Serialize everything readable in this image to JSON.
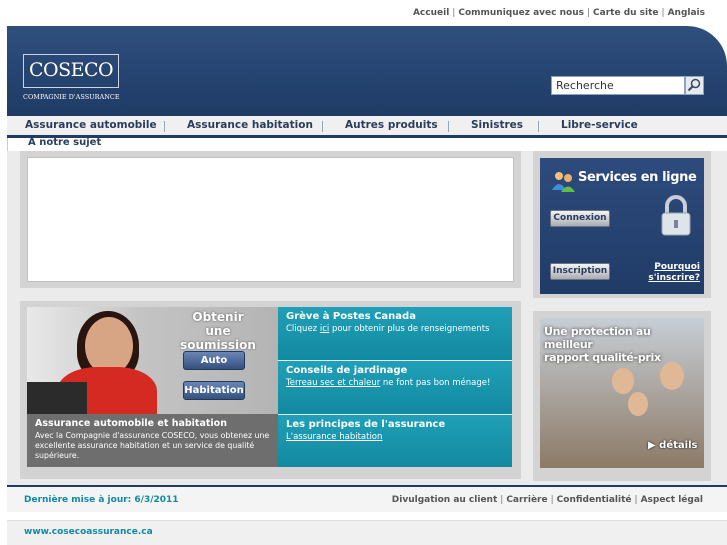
{
  "top_links": [
    "Accueil",
    "Communiquez avec nous",
    "Carte du site",
    "Anglais"
  ],
  "logo": {
    "name": "COSECO",
    "subtitle": "COMPAGNIE D'ASSURANCE"
  },
  "search": {
    "value": "Recherche"
  },
  "nav": {
    "items": [
      "Assurance automobile",
      "Assurance habitation",
      "Autres produits",
      "Sinistres",
      "Libre-service"
    ],
    "sub": "A notre sujet"
  },
  "services": {
    "title": "Services en ligne",
    "connexion": "Connexion",
    "inscription": "Inscription",
    "why_line1": "Pourquoi",
    "why_line2": "s'inscrire?"
  },
  "promo": {
    "title_line1": "Obtenir une",
    "title_line2": "soumission",
    "auto": "Auto",
    "habitation": "Habitation",
    "panel_title": "Assurance automobile et habitation",
    "panel_text": "Avec la Compagnie d'assurance COSECO, vous obtenez une excellente assurance habitation et un service de qualité supérieure."
  },
  "news": [
    {
      "title": "Grève à Postes Canada",
      "pre": "Cliquez ",
      "link": "ici",
      "post": " pour obtenir plus de renseignements"
    },
    {
      "title": "Conseils de jardinage",
      "pre": "",
      "link": "Terreau sec et chaleur",
      "post": " ne font pas bon ménage!"
    },
    {
      "title": "Les principes de l'assurance",
      "pre": "",
      "link": "L'assurance habitation",
      "post": ""
    }
  ],
  "family": {
    "title_line1": "Une protection au meilleur",
    "title_line2": "rapport qualité-prix",
    "link": "▶ détails"
  },
  "footer": {
    "updated": "Dernière mise à jour: 6/3/2011",
    "links": [
      "Divulgation au client",
      "Carrière",
      "Confidentialité",
      "Aspect légal"
    ],
    "url": "www.cosecoassurance.ca"
  },
  "colors": {
    "navy": "#1f3b66",
    "teal": "#1289a0",
    "promo_red": "#d42a22"
  }
}
